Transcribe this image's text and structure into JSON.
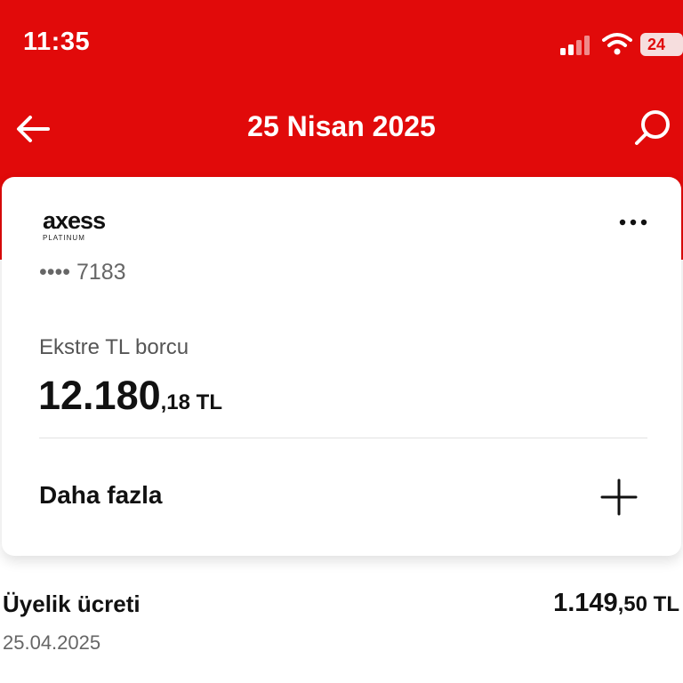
{
  "status_bar": {
    "time": "11:35",
    "battery": "24"
  },
  "nav": {
    "title": "25 Nisan 2025",
    "back_icon": "arrow-left-icon",
    "search_icon": "search-icon"
  },
  "card": {
    "brand": "axess",
    "tier": "PLATINUM",
    "masked_number": "•••• 7183",
    "more_icon": "ellipsis-icon",
    "debt_label": "Ekstre TL borcu",
    "debt_amount_main": "12.180",
    "debt_amount_decimal": ",18 TL",
    "expand_label": "Daha fazla",
    "expand_icon": "plus-icon"
  },
  "transactions": [
    {
      "title": "Üyelik ücreti",
      "date": "25.04.2025",
      "amount_main": "1.149",
      "amount_decimal": ",50 TL"
    }
  ],
  "colors": {
    "brand_red": "#e10a0a",
    "text_primary": "#111111",
    "text_secondary": "#666666"
  }
}
